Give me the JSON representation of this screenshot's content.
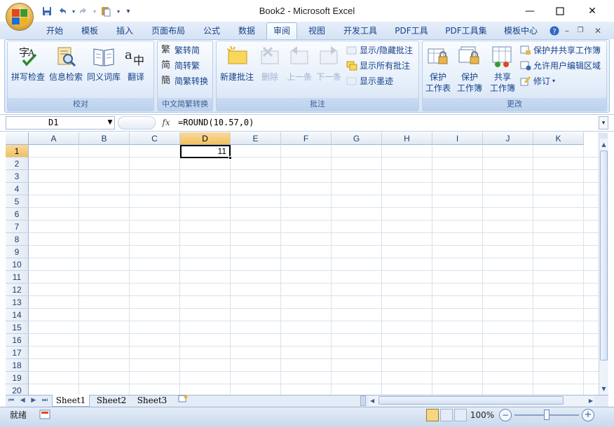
{
  "window": {
    "title": "Book2 - Microsoft Excel"
  },
  "quick_access": [
    "save-icon",
    "undo-icon",
    "redo-icon",
    "paste-icon",
    "customize-icon"
  ],
  "tabs": [
    {
      "label": "开始",
      "active": false
    },
    {
      "label": "模板",
      "active": false
    },
    {
      "label": "插入",
      "active": false
    },
    {
      "label": "页面布局",
      "active": false
    },
    {
      "label": "公式",
      "active": false
    },
    {
      "label": "数据",
      "active": false
    },
    {
      "label": "审阅",
      "active": true
    },
    {
      "label": "视图",
      "active": false
    },
    {
      "label": "开发工具",
      "active": false
    },
    {
      "label": "PDF工具",
      "active": false
    },
    {
      "label": "PDF工具集",
      "active": false
    },
    {
      "label": "模板中心",
      "active": false
    }
  ],
  "ribbon": {
    "proofing": {
      "label": "校对",
      "buttons": [
        "拼写检查",
        "信息检索",
        "同义词库",
        "翻译"
      ]
    },
    "chinese": {
      "label": "中文简繁转换",
      "buttons": [
        "繁转简",
        "简转繁",
        "简繁转换"
      ]
    },
    "comments": {
      "label": "批注",
      "big": [
        "新建批注",
        "删除",
        "上一条",
        "下一条"
      ],
      "small": [
        "显示/隐藏批注",
        "显示所有批注",
        "显示墨迹"
      ]
    },
    "changes": {
      "label": "更改",
      "big": [
        [
          "保护",
          "工作表"
        ],
        [
          "保护",
          "工作簿"
        ],
        [
          "共享",
          "工作簿"
        ]
      ],
      "small": [
        "保护并共享工作簿",
        "允许用户编辑区域",
        "修订"
      ]
    }
  },
  "formula_bar": {
    "name_box": "D1",
    "fx": "fx",
    "formula": "=ROUND(10.57,0)"
  },
  "grid": {
    "columns": [
      "A",
      "B",
      "C",
      "D",
      "E",
      "F",
      "G",
      "H",
      "I",
      "J",
      "K"
    ],
    "rows": [
      "1",
      "2",
      "3",
      "4",
      "5",
      "6",
      "7",
      "8",
      "9",
      "10",
      "11",
      "12",
      "13",
      "14",
      "15",
      "16",
      "17",
      "18",
      "19",
      "20"
    ],
    "selected_column": "D",
    "selected_row": "1",
    "active_cell_value": "11"
  },
  "sheets": [
    "Sheet1",
    "Sheet2",
    "Sheet3"
  ],
  "status": {
    "mode": "就绪",
    "zoom": "100%"
  },
  "colors": {
    "accent": "#15428b",
    "ribbon_bg": "#dbe7f6",
    "selected_header": "#f1c15f"
  }
}
